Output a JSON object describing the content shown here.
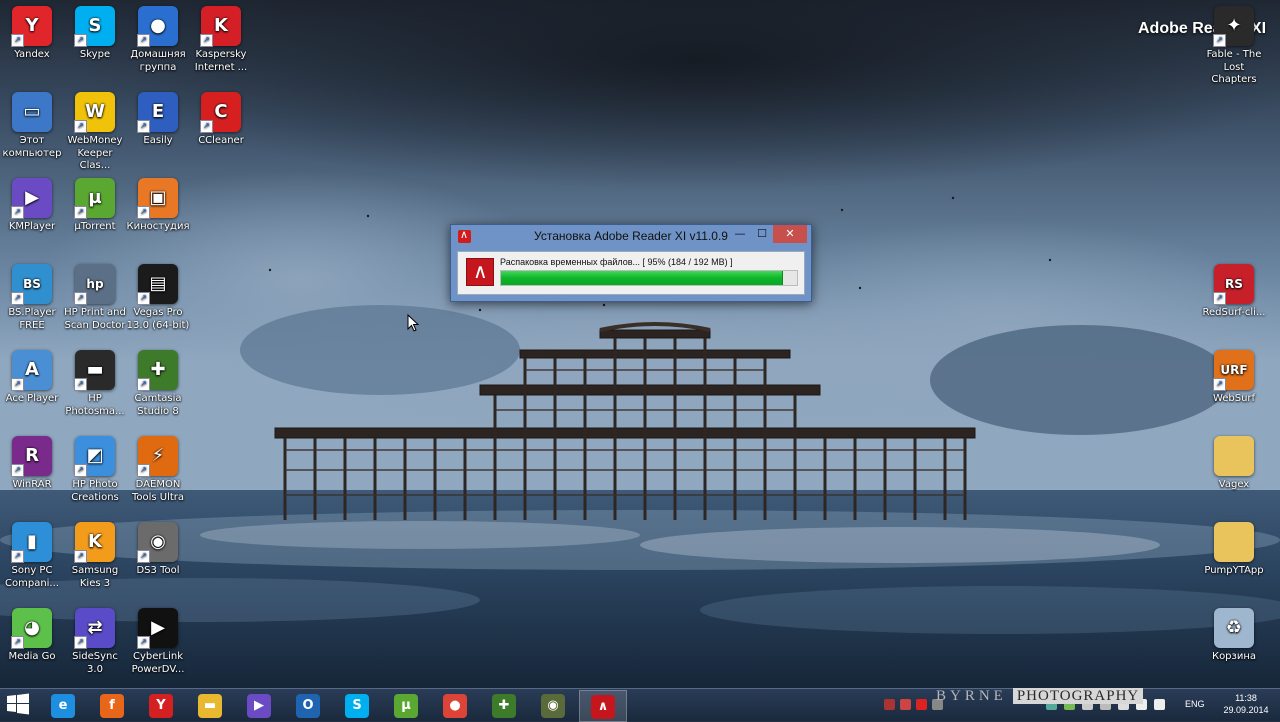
{
  "overlay_title": "Adobe Reader XI",
  "desktop_icons": [
    {
      "label": "Yandex",
      "icon": "yandex-icon",
      "color": "#e0262b"
    },
    {
      "label": "Skype",
      "icon": "skype-icon",
      "color": "#00aff0"
    },
    {
      "label": "Домашняя группа",
      "icon": "homegroup-icon",
      "color": "#2a6fd0"
    },
    {
      "label": "Kaspersky Internet ...",
      "icon": "kaspersky-icon",
      "color": "#d41f26"
    },
    {
      "label": "Этот компьютер",
      "icon": "this-pc-icon",
      "color": "#3d78c8"
    },
    {
      "label": "WebMoney Keeper Clas...",
      "icon": "webmoney-icon",
      "color": "#f0c20a"
    },
    {
      "label": "Easily",
      "icon": "easily-icon",
      "color": "#2e5fc0"
    },
    {
      "label": "CCleaner",
      "icon": "ccleaner-icon",
      "color": "#d62020"
    },
    {
      "label": "KMPlayer",
      "icon": "kmplayer-icon",
      "color": "#6a4bc4"
    },
    {
      "label": "µTorrent",
      "icon": "utorrent-icon",
      "color": "#5aa832"
    },
    {
      "label": "Киностудия",
      "icon": "movie-maker-icon",
      "color": "#e87826"
    },
    {
      "label": "BS.Player FREE",
      "icon": "bsplayer-icon",
      "color": "#2f8fcf"
    },
    {
      "label": "HP Print and Scan Doctor",
      "icon": "hp-print-icon",
      "color": "#5b6f86"
    },
    {
      "label": "Vegas Pro 13.0 (64-bit)",
      "icon": "vegas-icon",
      "color": "#1b1b1b"
    },
    {
      "label": "Ace Player",
      "icon": "ace-player-icon",
      "color": "#4a8fd4"
    },
    {
      "label": "HP Photosma...",
      "icon": "hp-photosmart-icon",
      "color": "#2a2a2a"
    },
    {
      "label": "Camtasia Studio 8",
      "icon": "camtasia-icon",
      "color": "#3d7a2a"
    },
    {
      "label": "WinRAR",
      "icon": "winrar-icon",
      "color": "#7a2a8a"
    },
    {
      "label": "HP Photo Creations",
      "icon": "hp-photo-icon",
      "color": "#3b8fdc"
    },
    {
      "label": "DAEMON Tools Ultra",
      "icon": "daemon-tools-icon",
      "color": "#e06a10"
    },
    {
      "label": "Sony PC Compani...",
      "icon": "sony-pc-icon",
      "color": "#2d8fd8"
    },
    {
      "label": "Samsung Kies 3",
      "icon": "samsung-kies-icon",
      "color": "#f39b1a"
    },
    {
      "label": "DS3 Tool",
      "icon": "ds3-tool-icon",
      "color": "#6b6b6b"
    },
    {
      "label": "Media Go",
      "icon": "media-go-icon",
      "color": "#5cc04a"
    },
    {
      "label": "SideSync 3.0",
      "icon": "sidesync-icon",
      "color": "#5a4bc8"
    },
    {
      "label": "CyberLink PowerDV...",
      "icon": "powerdvd-icon",
      "color": "#111111"
    },
    {
      "label": "Fable - The Lost Chapters",
      "icon": "fable-icon",
      "color": "#2a2a2a"
    },
    {
      "label": "RedSurf-cli...",
      "icon": "redsurf-icon",
      "color": "#c8202a"
    },
    {
      "label": "WebSurf",
      "icon": "websurf-icon",
      "color": "#e0701a"
    },
    {
      "label": "Vagex",
      "icon": "folder-icon",
      "color": "#e9c45c"
    },
    {
      "label": "PumpYTApp",
      "icon": "folder-icon",
      "color": "#e9c45c"
    },
    {
      "label": "Корзина",
      "icon": "recycle-bin-icon",
      "color": "#9fb6cf"
    }
  ],
  "installer": {
    "title": "Установка Adobe Reader XI v11.0.9",
    "status": "Распаковка временных файлов... [ 95% (184 / 192 MB) ]",
    "progress": 0.95,
    "minimize": "—",
    "maximize": "☐",
    "close": "✕"
  },
  "taskbar": {
    "items": [
      {
        "name": "internet-explorer",
        "glyph": "e",
        "color": "#1e8fe0"
      },
      {
        "name": "firefox",
        "glyph": "f",
        "color": "#e8661a"
      },
      {
        "name": "yandex-browser",
        "glyph": "Y",
        "color": "#d42020"
      },
      {
        "name": "file-explorer",
        "glyph": "▬",
        "color": "#e8b830"
      },
      {
        "name": "kmplayer",
        "glyph": "▶",
        "color": "#6a4bc4"
      },
      {
        "name": "outlook",
        "glyph": "O",
        "color": "#1f64b0"
      },
      {
        "name": "skype",
        "glyph": "S",
        "color": "#00aff0"
      },
      {
        "name": "utorrent",
        "glyph": "µ",
        "color": "#5aa832"
      },
      {
        "name": "chrome",
        "glyph": "●",
        "color": "#db4437"
      },
      {
        "name": "camtasia",
        "glyph": "✚",
        "color": "#3d7a2a"
      },
      {
        "name": "camtasia-recorder",
        "glyph": "◉",
        "color": "#5a6a3a"
      },
      {
        "name": "adobe-reader-installer",
        "glyph": "∧",
        "color": "#c4161c"
      }
    ],
    "language": "ENG",
    "time": "11:38",
    "date": "29.09.2014",
    "watermark": "BYRNE",
    "watermark_tag": "PHOTOGRAPHY"
  }
}
